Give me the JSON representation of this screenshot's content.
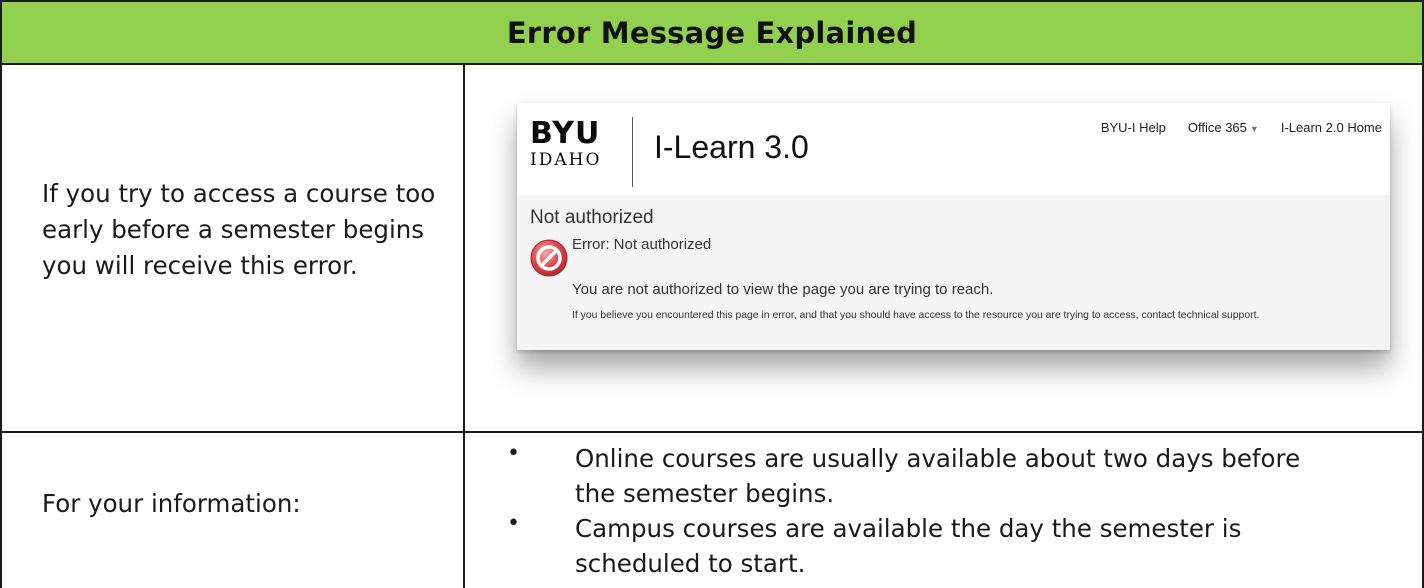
{
  "header": {
    "title": "Error Message Explained"
  },
  "row1": {
    "text": "If you try to access a course too early before a semester begins you will receive this error."
  },
  "screenshot": {
    "logo": {
      "top": "BYU",
      "bottom": "IDAHO"
    },
    "app_title": "I-Learn 3.0",
    "nav": [
      "BYU-I Help",
      "Office 365",
      "I-Learn 2.0 Home"
    ],
    "heading": "Not authorized",
    "error_title": "Error: Not authorized",
    "error_message": "You are not authorized to view the page you are trying to reach.",
    "error_note": "If you believe you encountered this page in error, and that you should have access to the resource you are trying to access, contact technical support.",
    "colors": {
      "icon_red": "#e0474f",
      "header_bg": "#ffffff",
      "body_bg": "#f5f5f5"
    }
  },
  "row2": {
    "label": "For your information:",
    "bullets": [
      "Online courses are usually available about two days before the semester begins.",
      "Campus courses are available the day the semester is scheduled to start."
    ]
  },
  "colors": {
    "header_green": "#92d050",
    "border": "#1a1a1a"
  }
}
